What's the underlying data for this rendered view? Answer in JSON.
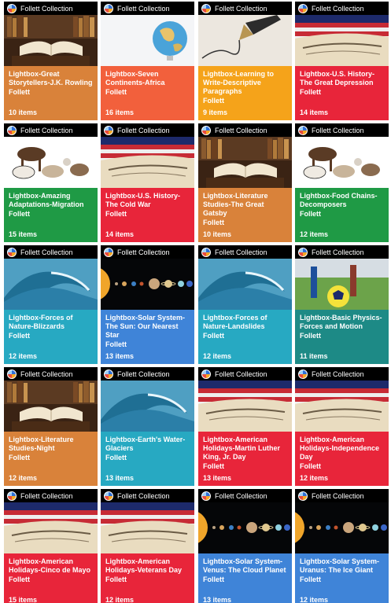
{
  "collection_label": "Follett Collection",
  "colors": {
    "orange": "#d9823a",
    "red": "#e8253a",
    "green": "#1f9a45",
    "teal": "#27a9c2",
    "blue": "#3f84d8",
    "orange_bright": "#f5a31a",
    "coral": "#f2603c",
    "dark_teal": "#1d8a86"
  },
  "cards": [
    {
      "title": "Lightbox-Great Storytellers-J.K. Rowling",
      "publisher": "Follett",
      "count": "10 items",
      "color": "#d9823a",
      "image": "books"
    },
    {
      "title": "Lightbox-Seven Continents-Africa",
      "publisher": "Follett",
      "count": "16 items",
      "color": "#f2603c",
      "image": "globe"
    },
    {
      "title": "Lightbox-Learning to Write-Descriptive Paragraphs",
      "publisher": "Follett",
      "count": "9 items",
      "color": "#f5a31a",
      "image": "pen"
    },
    {
      "title": "Lightbox-U.S. History-The Great Depression",
      "publisher": "Follett",
      "count": "14 items",
      "color": "#e8253a",
      "image": "flag"
    },
    {
      "title": "Lightbox-Amazing Adaptations-Migration",
      "publisher": "Follett",
      "count": "15 items",
      "color": "#1f9a45",
      "image": "animals"
    },
    {
      "title": "Lightbox-U.S. History-The Cold War",
      "publisher": "Follett",
      "count": "14 items",
      "color": "#e8253a",
      "image": "flag"
    },
    {
      "title": "Lightbox-Literature Studies-The Great Gatsby",
      "publisher": "Follett",
      "count": "10 items",
      "color": "#d9823a",
      "image": "books"
    },
    {
      "title": "Lightbox-Food Chains-Decomposers",
      "publisher": "Follett",
      "count": "12 items",
      "color": "#1f9a45",
      "image": "animals"
    },
    {
      "title": "Lightbox-Forces of Nature-Blizzards",
      "publisher": "Follett",
      "count": "12 items",
      "color": "#27a9c2",
      "image": "wave"
    },
    {
      "title": "Lightbox-Solar System-The Sun: Our Nearest Star",
      "publisher": "Follett",
      "count": "13 items",
      "color": "#3f84d8",
      "image": "planets"
    },
    {
      "title": "Lightbox-Forces of Nature-Landslides",
      "publisher": "Follett",
      "count": "12 items",
      "color": "#27a9c2",
      "image": "wave"
    },
    {
      "title": "Lightbox-Basic Physics-Forces and Motion",
      "publisher": "Follett",
      "count": "11 items",
      "color": "#1d8a86",
      "image": "soccer"
    },
    {
      "title": "Lightbox-Literature Studies-Night",
      "publisher": "Follett",
      "count": "12 items",
      "color": "#d9823a",
      "image": "books"
    },
    {
      "title": "Lightbox-Earth's Water-Glaciers",
      "publisher": "Follett",
      "count": "13 items",
      "color": "#27a9c2",
      "image": "wave"
    },
    {
      "title": "Lightbox-American Holidays-Martin Luther King, Jr. Day",
      "publisher": "Follett",
      "count": "13 items",
      "color": "#e8253a",
      "image": "flag"
    },
    {
      "title": "Lightbox-American Holidays-Independence Day",
      "publisher": "Follett",
      "count": "12 items",
      "color": "#e8253a",
      "image": "flag"
    },
    {
      "title": "Lightbox-American Holidays-Cinco de Mayo",
      "publisher": "Follett",
      "count": "15 items",
      "color": "#e8253a",
      "image": "flag"
    },
    {
      "title": "Lightbox-American Holidays-Veterans Day",
      "publisher": "Follett",
      "count": "12 items",
      "color": "#e8253a",
      "image": "flag"
    },
    {
      "title": "Lightbox-Solar System-Venus: The Cloud Planet",
      "publisher": "Follett",
      "count": "13 items",
      "color": "#3f84d8",
      "image": "planets"
    },
    {
      "title": "Lightbox-Solar System-Uranus: The Ice Giant",
      "publisher": "Follett",
      "count": "12 items",
      "color": "#3f84d8",
      "image": "planets"
    }
  ]
}
